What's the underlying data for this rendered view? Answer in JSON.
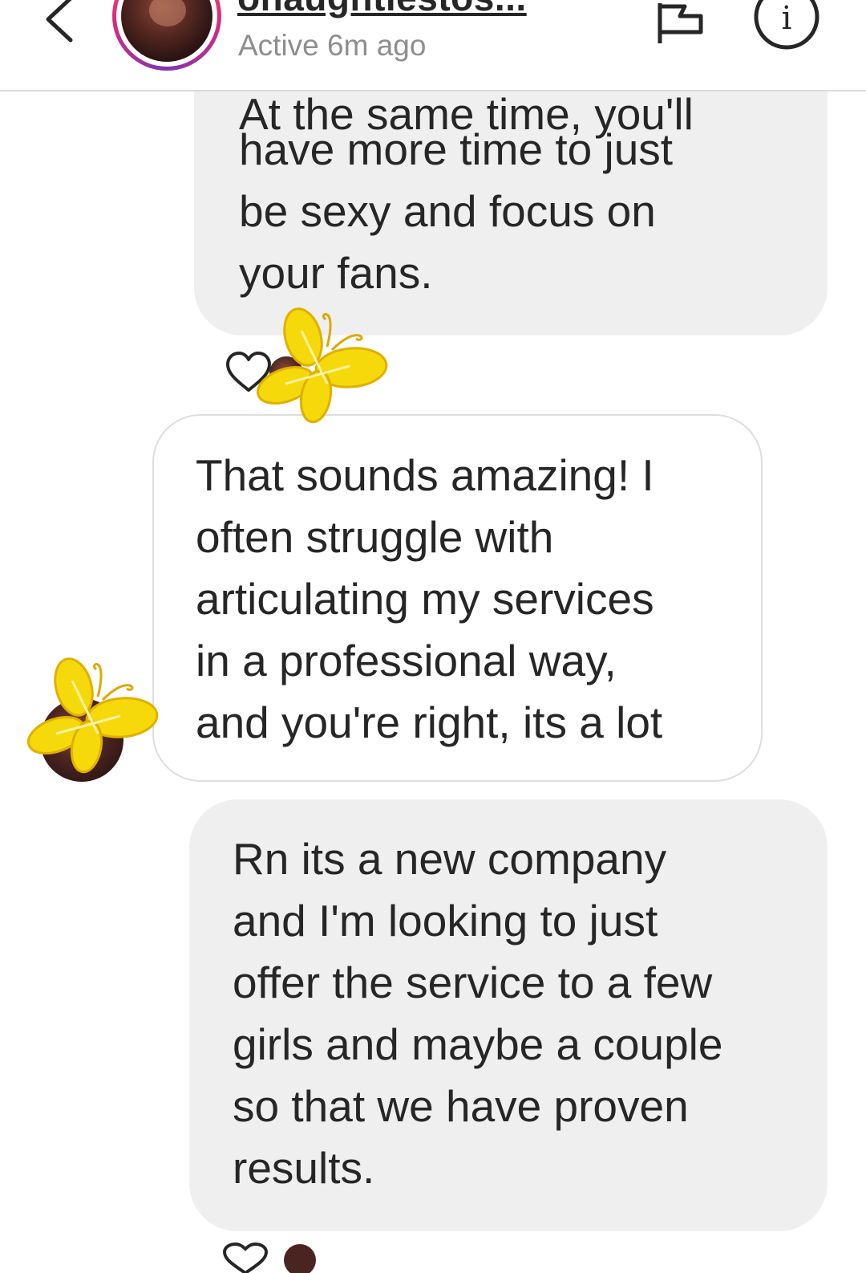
{
  "header": {
    "username": "onaughtiestos...",
    "status": "Active 6m ago",
    "icons": {
      "back": "chevron-left-icon",
      "flag": "flag-icon",
      "info": "info-icon"
    }
  },
  "messages": [
    {
      "direction": "received",
      "partial_top_line": "At the same time, you'll",
      "lines": [
        "have more time to just",
        "be sexy and focus on",
        "your fans."
      ],
      "reaction": "heart"
    },
    {
      "direction": "sent",
      "lines": [
        "That sounds amazing! I",
        "often struggle with",
        "articulating my services",
        "in a professional way,",
        "and you're right, its a lot"
      ]
    },
    {
      "direction": "received",
      "lines": [
        "Rn its a new company",
        "and I'm looking to just",
        "offer the service to a few",
        "girls and maybe a couple",
        "so that we have proven",
        "results."
      ]
    }
  ],
  "colors": {
    "received_bubble": "#efefef",
    "sent_bubble_border": "#dedede",
    "text": "#262626",
    "status_text": "#8e8e8e",
    "sticker_yellow": "#f5d90a"
  },
  "stickers": [
    "butterfly-sticker",
    "butterfly-sticker"
  ]
}
